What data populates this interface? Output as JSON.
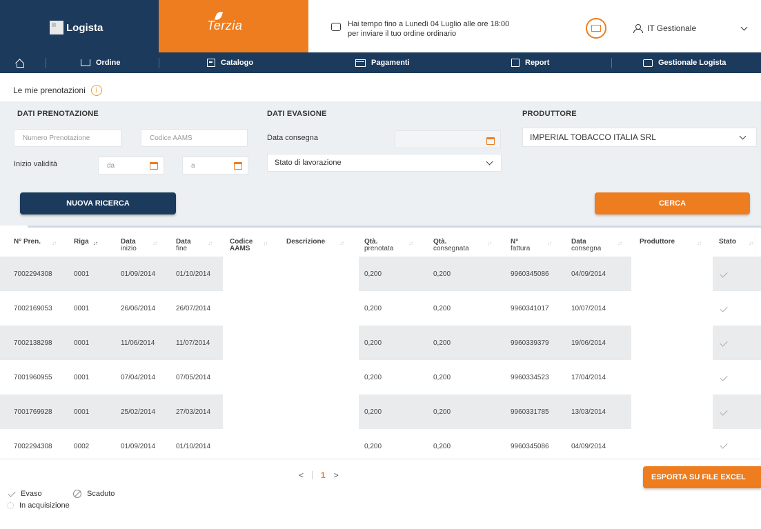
{
  "header": {
    "logo_text": "Logista",
    "brand_text": "Terzia",
    "notice_line1": "Hai tempo fino a Lunedì 04 Luglio alle ore 18:00",
    "notice_line2": "per inviare il tuo ordine ordinario",
    "user_name": "IT Gestionale"
  },
  "nav": {
    "ordine": "Ordine",
    "catalogo": "Catalogo",
    "pagamenti": "Pagamenti",
    "report": "Report",
    "gestionale": "Gestionale Logista"
  },
  "page_title": "Le mie prenotazioni",
  "filters": {
    "section_prenotazione": "DATI PRENOTAZIONE",
    "section_evasione": "DATI EVASIONE",
    "section_produttore": "PRODUTTORE",
    "numero_placeholder": "Numero Prenotazione",
    "codice_placeholder": "Codice AAMS",
    "inizio_label": "Inizio validità",
    "da_placeholder": "da",
    "a_placeholder": "a",
    "data_consegna_label": "Data consegna",
    "stato_select": "Stato di lavorazione",
    "produttore_select": "IMPERIAL TOBACCO ITALIA SRL",
    "nuova_ricerca": "NUOVA RICERCA",
    "cerca": "CERCA"
  },
  "table": {
    "headers": {
      "pren": "N° Pren.",
      "riga": "Riga",
      "data_inizio_1": "Data",
      "data_inizio_2": "inizio",
      "data_fine_1": "Data",
      "data_fine_2": "fine",
      "codice_1": "Codice",
      "codice_2": "AAMS",
      "descrizione": "Descrizione",
      "qta_pren_1": "Qtà.",
      "qta_pren_2": "prenotata",
      "qta_cons_1": "Qtà.",
      "qta_cons_2": "consegnata",
      "fattura_1": "N°",
      "fattura_2": "fattura",
      "data_cons_1": "Data",
      "data_cons_2": "consegna",
      "produttore": "Produttore",
      "stato": "Stato"
    },
    "rows": [
      {
        "pren": "7002294308",
        "riga": "0001",
        "inizio": "01/09/2014",
        "fine": "01/10/2014",
        "qta_pren": "0,200",
        "qta_cons": "0,200",
        "fattura": "9960345086",
        "consegna": "04/09/2014"
      },
      {
        "pren": "7002169053",
        "riga": "0001",
        "inizio": "26/06/2014",
        "fine": "26/07/2014",
        "qta_pren": "0,200",
        "qta_cons": "0,200",
        "fattura": "9960341017",
        "consegna": "10/07/2014"
      },
      {
        "pren": "7002138298",
        "riga": "0001",
        "inizio": "11/06/2014",
        "fine": "11/07/2014",
        "qta_pren": "0,200",
        "qta_cons": "0,200",
        "fattura": "9960339379",
        "consegna": "19/06/2014"
      },
      {
        "pren": "7001960955",
        "riga": "0001",
        "inizio": "07/04/2014",
        "fine": "07/05/2014",
        "qta_pren": "0,200",
        "qta_cons": "0,200",
        "fattura": "9960334523",
        "consegna": "17/04/2014"
      },
      {
        "pren": "7001769928",
        "riga": "0001",
        "inizio": "25/02/2014",
        "fine": "27/03/2014",
        "qta_pren": "0,200",
        "qta_cons": "0,200",
        "fattura": "9960331785",
        "consegna": "13/03/2014"
      },
      {
        "pren": "7002294308",
        "riga": "0002",
        "inizio": "01/09/2014",
        "fine": "01/10/2014",
        "qta_pren": "0,200",
        "qta_cons": "0,200",
        "fattura": "9960345086",
        "consegna": "04/09/2014"
      }
    ]
  },
  "pagination": {
    "prev": "<",
    "current": "1",
    "next": ">"
  },
  "export_label": "ESPORTA SU FILE EXCEL",
  "legend": {
    "evaso": "Evaso",
    "scaduto": "Scaduto",
    "acquisizione": "In acquisizione"
  },
  "colors": {
    "navy": "#1b3a5c",
    "orange": "#ee7d1f"
  }
}
